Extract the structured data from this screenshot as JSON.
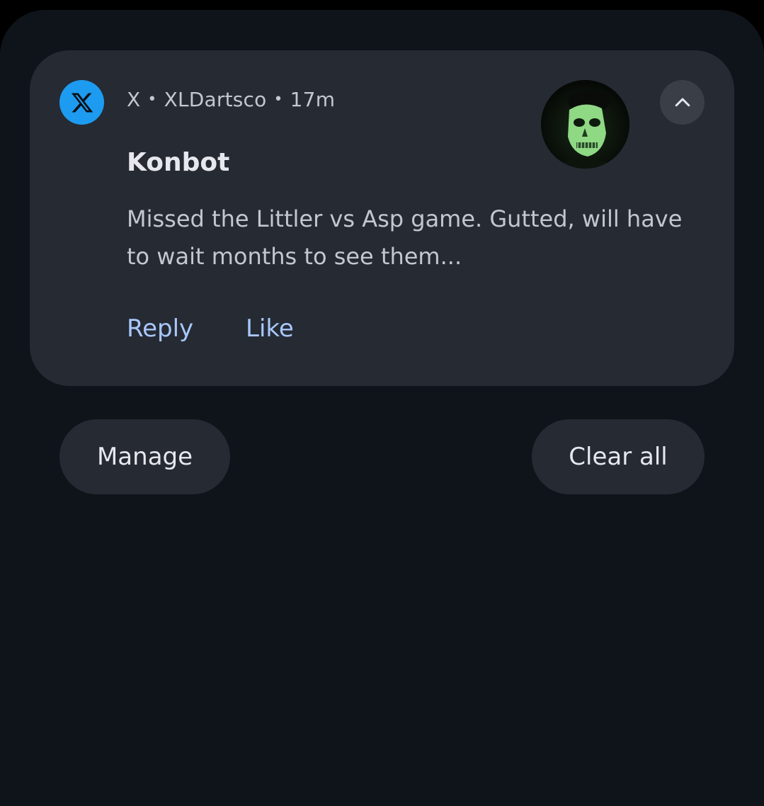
{
  "notification": {
    "app_name": "X",
    "separator": "•",
    "account": "XLDartsco",
    "time": "17m",
    "title": "Konbot",
    "body": "Missed the Littler vs Asp game. Gutted, will have to wait months to see them...",
    "avatar_icon": "skull-avatar-icon",
    "app_icon": "x-logo-icon",
    "expand_icon": "chevron-up-icon",
    "actions": {
      "reply": "Reply",
      "like": "Like"
    }
  },
  "footer": {
    "manage_label": "Manage",
    "clear_all_label": "Clear all"
  },
  "colors": {
    "background": "#0f141b",
    "card": "#252a33",
    "accent": "#a8c7fa",
    "app_icon_bg": "#1d9bf0"
  }
}
